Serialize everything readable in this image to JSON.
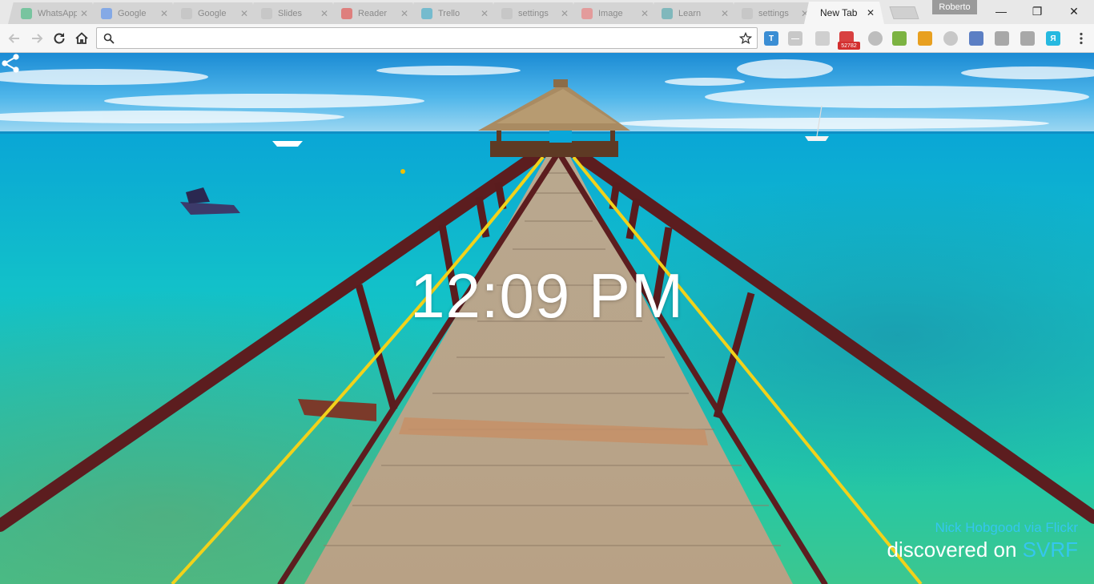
{
  "tabs": [
    {
      "title": "WhatsApp",
      "favicon_color": "#2bb673"
    },
    {
      "title": "Google",
      "favicon_color": "#4285f4"
    },
    {
      "title": "Google",
      "favicon_color": "#bbbbbb"
    },
    {
      "title": "Slides",
      "favicon_color": "#bbbbbb"
    },
    {
      "title": "Reader",
      "favicon_color": "#e53935"
    },
    {
      "title": "Trello",
      "favicon_color": "#26a6c9"
    },
    {
      "title": "settings",
      "favicon_color": "#bbbbbb"
    },
    {
      "title": "Image",
      "favicon_color": "#ef6b6b"
    },
    {
      "title": "Learn",
      "favicon_color": "#3aa0a8"
    },
    {
      "title": "settings",
      "favicon_color": "#bbbbbb"
    }
  ],
  "active_tab": {
    "title": "New Tab"
  },
  "profile_name": "Roberto",
  "window_controls": {
    "minimize": "—",
    "restore": "❐",
    "close": "✕"
  },
  "omnibox": {
    "value": "",
    "placeholder": ""
  },
  "extensions": [
    {
      "name": "blue-t-extension-icon",
      "color": "#3b8ed4",
      "glyph": "T"
    },
    {
      "name": "gray-dash-extension-icon",
      "color": "#c8c8c8",
      "glyph": "—"
    },
    {
      "name": "shield-extension-icon",
      "color": "#cfcfcf",
      "glyph": ""
    },
    {
      "name": "red-car-extension-icon",
      "color": "#d84040",
      "glyph": ""
    },
    {
      "name": "gear-extension-icon",
      "color": "#bdbdbd",
      "glyph": ""
    },
    {
      "name": "android-extension-icon",
      "color": "#7cb342",
      "glyph": ""
    },
    {
      "name": "chrome-extension-icon",
      "color": "#e8a020",
      "glyph": ""
    },
    {
      "name": "circle-extension-icon",
      "color": "#c8c8c8",
      "glyph": ""
    },
    {
      "name": "blue-square-extension-icon",
      "color": "#5c7fc4",
      "glyph": ""
    },
    {
      "name": "feather-extension-icon",
      "color": "#a8a8a8",
      "glyph": ""
    },
    {
      "name": "mic-extension-icon",
      "color": "#a8a8a8",
      "glyph": ""
    },
    {
      "name": "cyan-extension-icon",
      "color": "#26b9e0",
      "glyph": "Я"
    }
  ],
  "extension_badge": "52782",
  "clock": "12:09 PM",
  "credit": {
    "photographer": "Nick Hobgood via Flickr",
    "discovered_prefix": "discovered on ",
    "brand": "SVRF"
  },
  "colors": {
    "accent": "#35c6ef",
    "tab_active": "#f6f6f6",
    "tab_inactive": "#d4d4d4"
  }
}
